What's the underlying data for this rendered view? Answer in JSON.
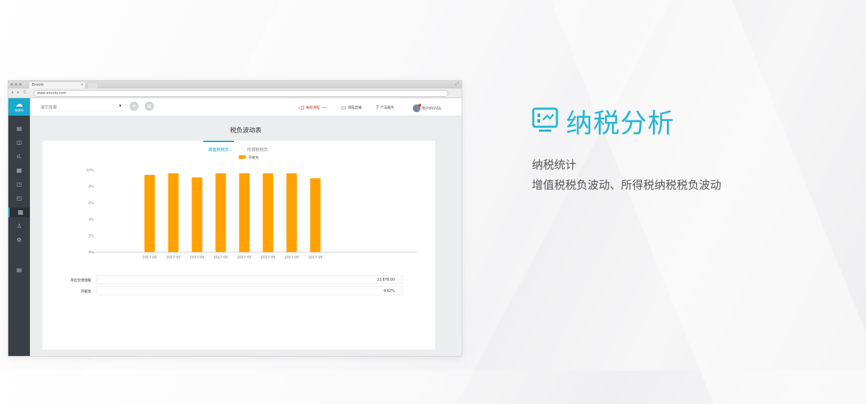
{
  "browser": {
    "tab_title": "Envolo",
    "tab_close": "×",
    "expand": "⤢",
    "nav": "◂ ▸ C",
    "url": "www.envolo.com"
  },
  "app": {
    "brand_icon": "☁",
    "brand_text": "税律师",
    "company_select": "演示账套",
    "caret": "▾",
    "add_icon": "+",
    "grid_icon": "⊞",
    "toolbar": {
      "promo_icon": "◁)",
      "promo_text": "美税课程 →→",
      "live_icon": "▭",
      "live_text": "课程直播",
      "help_icon": "?",
      "service_text": "产品服务",
      "user_text": "用户BVVZJy"
    },
    "sidebar_icons": [
      "▤",
      "◫",
      "ıl.",
      "▦",
      "◳",
      "◰",
      "▥",
      "♙",
      "⚙",
      "▤"
    ]
  },
  "page": {
    "title": "税负波动表",
    "tabs": [
      "增值税税负",
      "所得税税负"
    ],
    "active_tab": 0,
    "summary": [
      {
        "label": "月应交增值税",
        "value": "13,878.00"
      },
      {
        "label": "月税负",
        "value": "9.62%"
      }
    ]
  },
  "chart_data": {
    "type": "bar",
    "categories": [
      "2017-05",
      "2017-05",
      "2017-05",
      "2017-05",
      "2017-05",
      "2017-05",
      "2017-05",
      "2017-05"
    ],
    "series": [
      {
        "name": "月税负",
        "values": [
          9.4,
          9.6,
          9.1,
          9.6,
          9.6,
          9.6,
          9.6,
          9.0
        ]
      }
    ],
    "ytick_labels": [
      "0%",
      "2%",
      "4%",
      "6%",
      "8%",
      "10%"
    ],
    "ylim": [
      0,
      10
    ],
    "bar_color": "#ffa200",
    "legend_position": "top-center",
    "grid": false
  },
  "panel": {
    "heading": "纳税分析",
    "line1": "纳税统计",
    "line2": "增值税税负波动、所得税纳税税负波动",
    "accent_color": "#25b6d4"
  }
}
